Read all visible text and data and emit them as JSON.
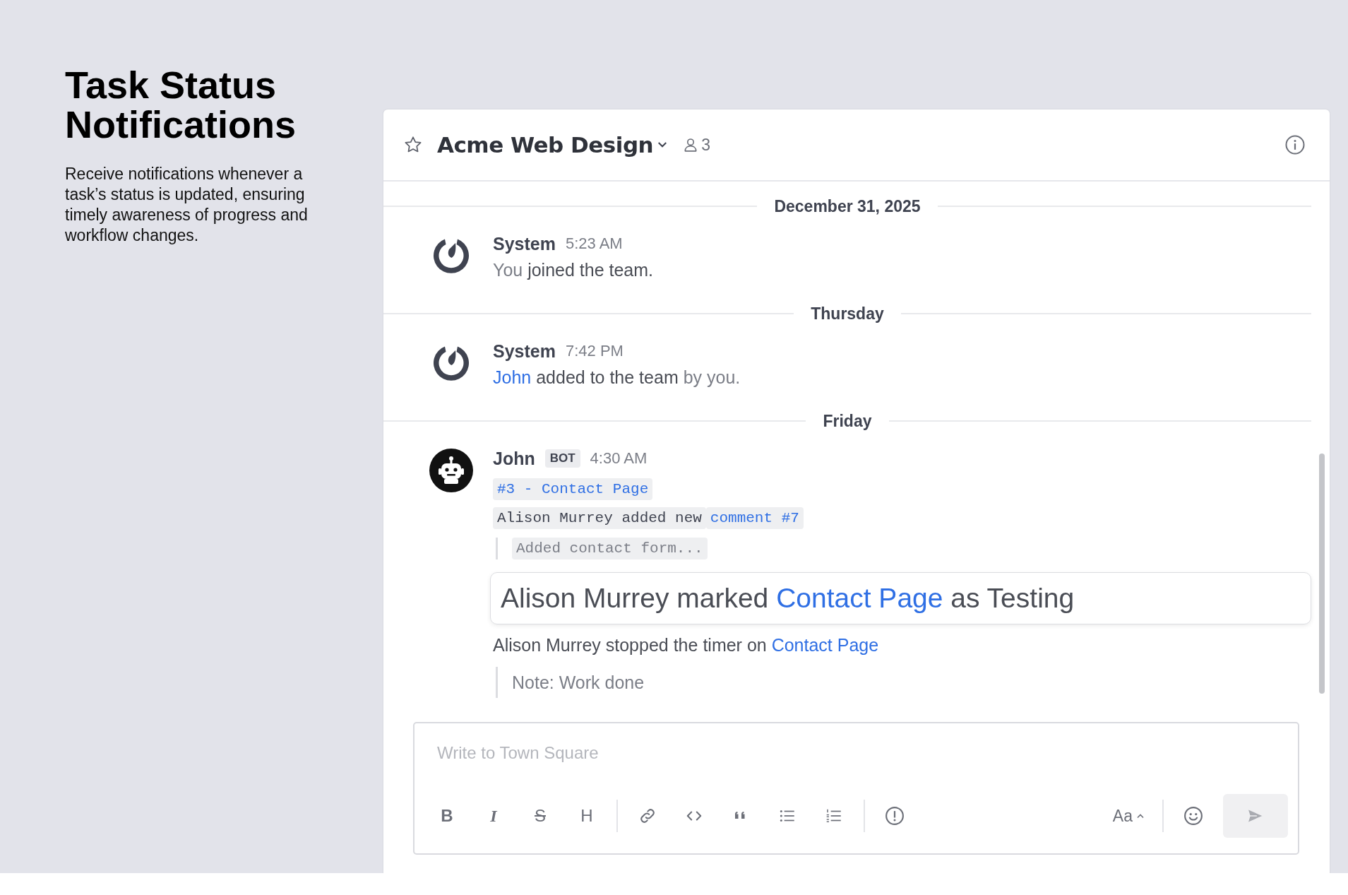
{
  "intro": {
    "title": "Task Status Notifications",
    "description": "Receive notifications whenever a task’s status is updated, ensuring timely awareness of progress and workflow changes."
  },
  "channel": {
    "name": "Acme Web Design",
    "favorite": false,
    "member_count": "3"
  },
  "timeline": [
    {
      "kind": "separator",
      "label": "December 31, 2025"
    },
    {
      "kind": "system_message",
      "author": "System",
      "time": "5:23 AM",
      "lines": [
        {
          "kind": "text",
          "segments": [
            {
              "text": "You ",
              "kind": "muted"
            },
            {
              "text": "joined the team.",
              "kind": "strong"
            }
          ]
        }
      ]
    },
    {
      "kind": "separator",
      "label": "Thursday"
    },
    {
      "kind": "system_message",
      "author": "System",
      "time": "7:42 PM",
      "lines": [
        {
          "kind": "text",
          "segments": [
            {
              "text": "John",
              "kind": "link"
            },
            {
              "text": " added to the team",
              "kind": "strong"
            },
            {
              "text": " by you.",
              "kind": "muted"
            }
          ]
        }
      ]
    },
    {
      "kind": "separator",
      "label": "Friday"
    },
    {
      "kind": "bot_message",
      "author": "John",
      "badge": "BOT",
      "time": "4:30 AM",
      "lines": [
        {
          "kind": "code",
          "segments": [
            {
              "text": "#3 - Contact Page",
              "kind": "link"
            }
          ]
        },
        {
          "kind": "code",
          "segments": [
            {
              "text": "Alison Murrey added new",
              "kind": "strong"
            },
            {
              "text": "comment #7",
              "kind": "link"
            }
          ]
        },
        {
          "kind": "quote_code",
          "segments": [
            {
              "text": "Added contact form...",
              "kind": "muted"
            }
          ]
        },
        {
          "kind": "highlight",
          "segments": [
            {
              "text": "Alison Murrey marked ",
              "kind": "strong"
            },
            {
              "text": "Contact Page",
              "kind": "link"
            },
            {
              "text": " as Testing",
              "kind": "strong"
            }
          ]
        },
        {
          "kind": "text",
          "segments": [
            {
              "text": "Alison Murrey stopped the timer on ",
              "kind": "strong"
            },
            {
              "text": "Contact Page",
              "kind": "link"
            }
          ]
        },
        {
          "kind": "quote",
          "segments": [
            {
              "text": "Note: Work done",
              "kind": "muted"
            }
          ]
        }
      ]
    }
  ],
  "composer": {
    "placeholder": "Write to Town Square",
    "tool_groups": [
      [
        {
          "kind": "bold",
          "label": "B"
        },
        {
          "kind": "italic",
          "label": "I"
        },
        {
          "kind": "strike",
          "label": "S"
        },
        {
          "kind": "heading",
          "label": "H"
        }
      ],
      [
        {
          "kind": "link"
        },
        {
          "kind": "code"
        },
        {
          "kind": "quote"
        },
        {
          "kind": "bullets"
        },
        {
          "kind": "numbers"
        }
      ],
      [
        {
          "kind": "priority"
        }
      ]
    ],
    "format_label": "Aa",
    "send_disabled": true
  }
}
